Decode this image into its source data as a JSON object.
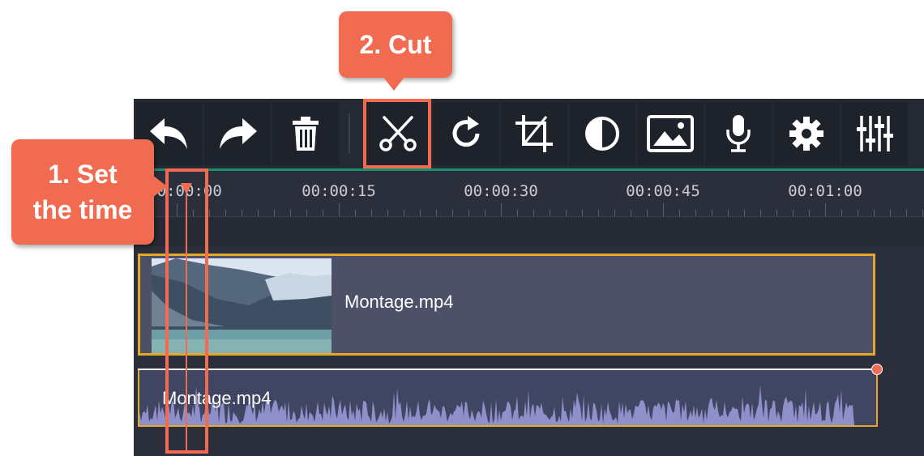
{
  "toolbar": {
    "buttons": [
      {
        "name": "undo",
        "icon": "undo-icon"
      },
      {
        "name": "redo",
        "icon": "redo-icon"
      },
      {
        "name": "delete",
        "icon": "trash-icon"
      },
      {
        "name": "cut",
        "icon": "scissors-icon"
      },
      {
        "name": "rotate",
        "icon": "rotate-icon"
      },
      {
        "name": "crop",
        "icon": "crop-icon"
      },
      {
        "name": "color-adjustments",
        "icon": "contrast-icon"
      },
      {
        "name": "image",
        "icon": "image-icon"
      },
      {
        "name": "record-audio",
        "icon": "microphone-icon"
      },
      {
        "name": "settings",
        "icon": "gear-icon"
      },
      {
        "name": "equalizer",
        "icon": "sliders-icon"
      }
    ]
  },
  "ruler": {
    "labels": [
      "00:00:00",
      "00:00:15",
      "00:00:30",
      "00:00:45",
      "00:01:00"
    ]
  },
  "timeline": {
    "video_clip_name": "Montage.mp4",
    "audio_clip_name": "Montage.mp4"
  },
  "callouts": {
    "cut_label": "2. Cut",
    "set_time_line1": "1. Set",
    "set_time_line2": "the time"
  },
  "colors": {
    "callout": "#f06b50",
    "clip_border": "#e6a82a",
    "accent_green": "#1d8f6f",
    "panel_bg": "#2b2f3b"
  }
}
